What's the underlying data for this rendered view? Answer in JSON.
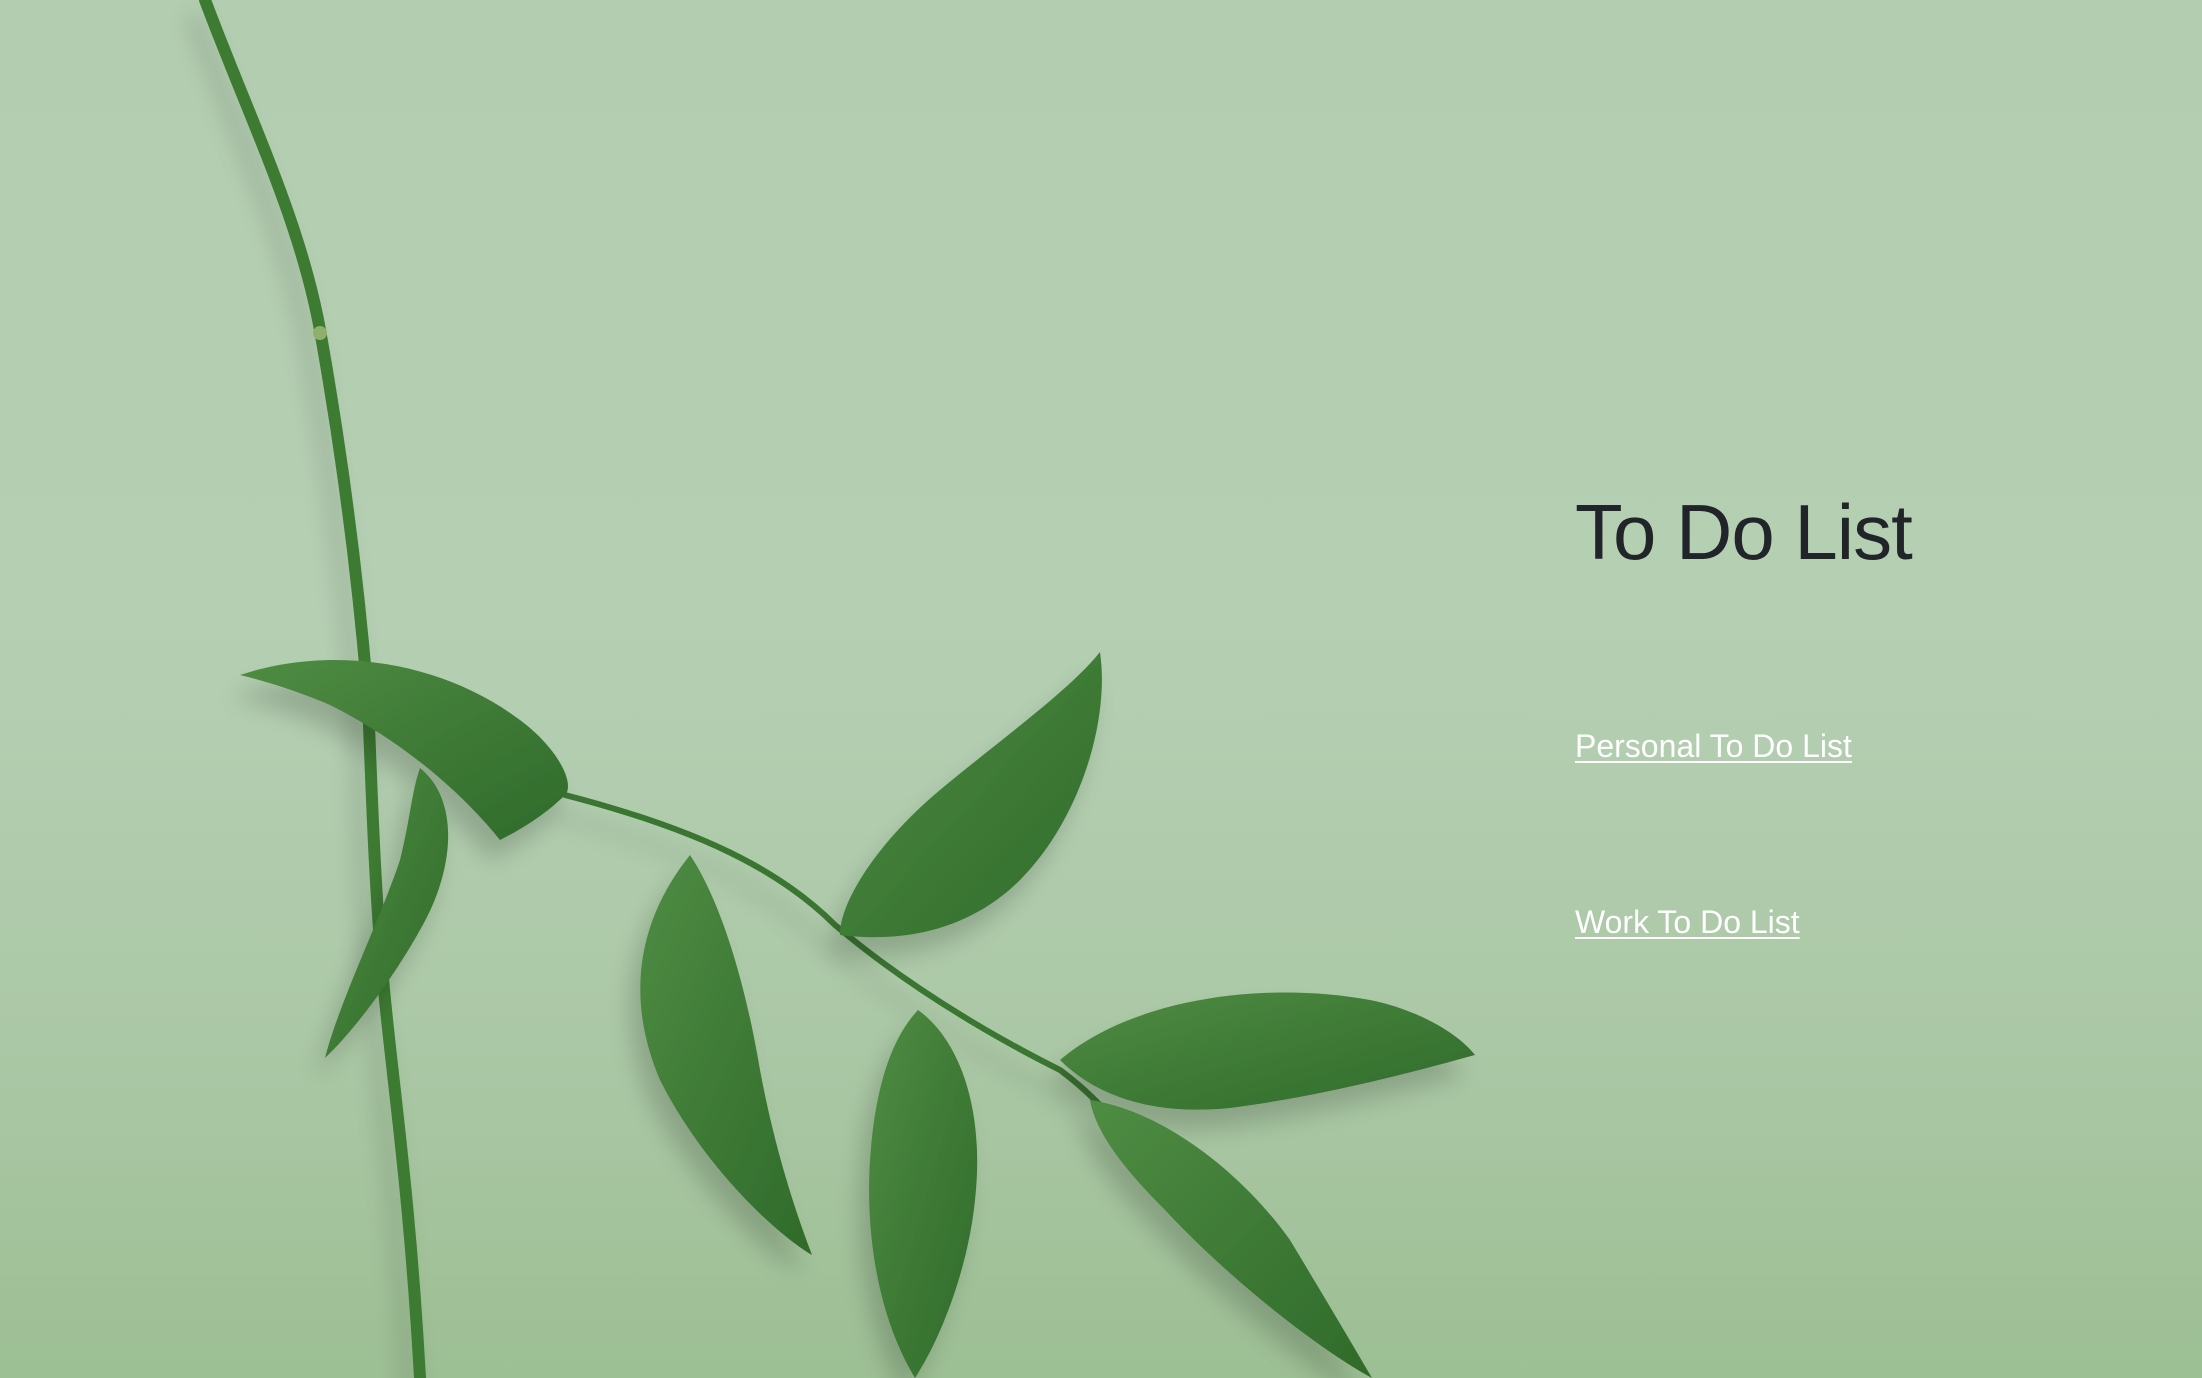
{
  "page": {
    "title": "To Do List"
  },
  "links": [
    {
      "label": "Personal To Do List"
    },
    {
      "label": "Work To Do List"
    }
  ],
  "colors": {
    "background": "#b3cdb0",
    "title": "#212529",
    "link": "#ffffff",
    "leaf": "#3d7a34"
  },
  "background_image": "green-plant-stem-with-leaves"
}
